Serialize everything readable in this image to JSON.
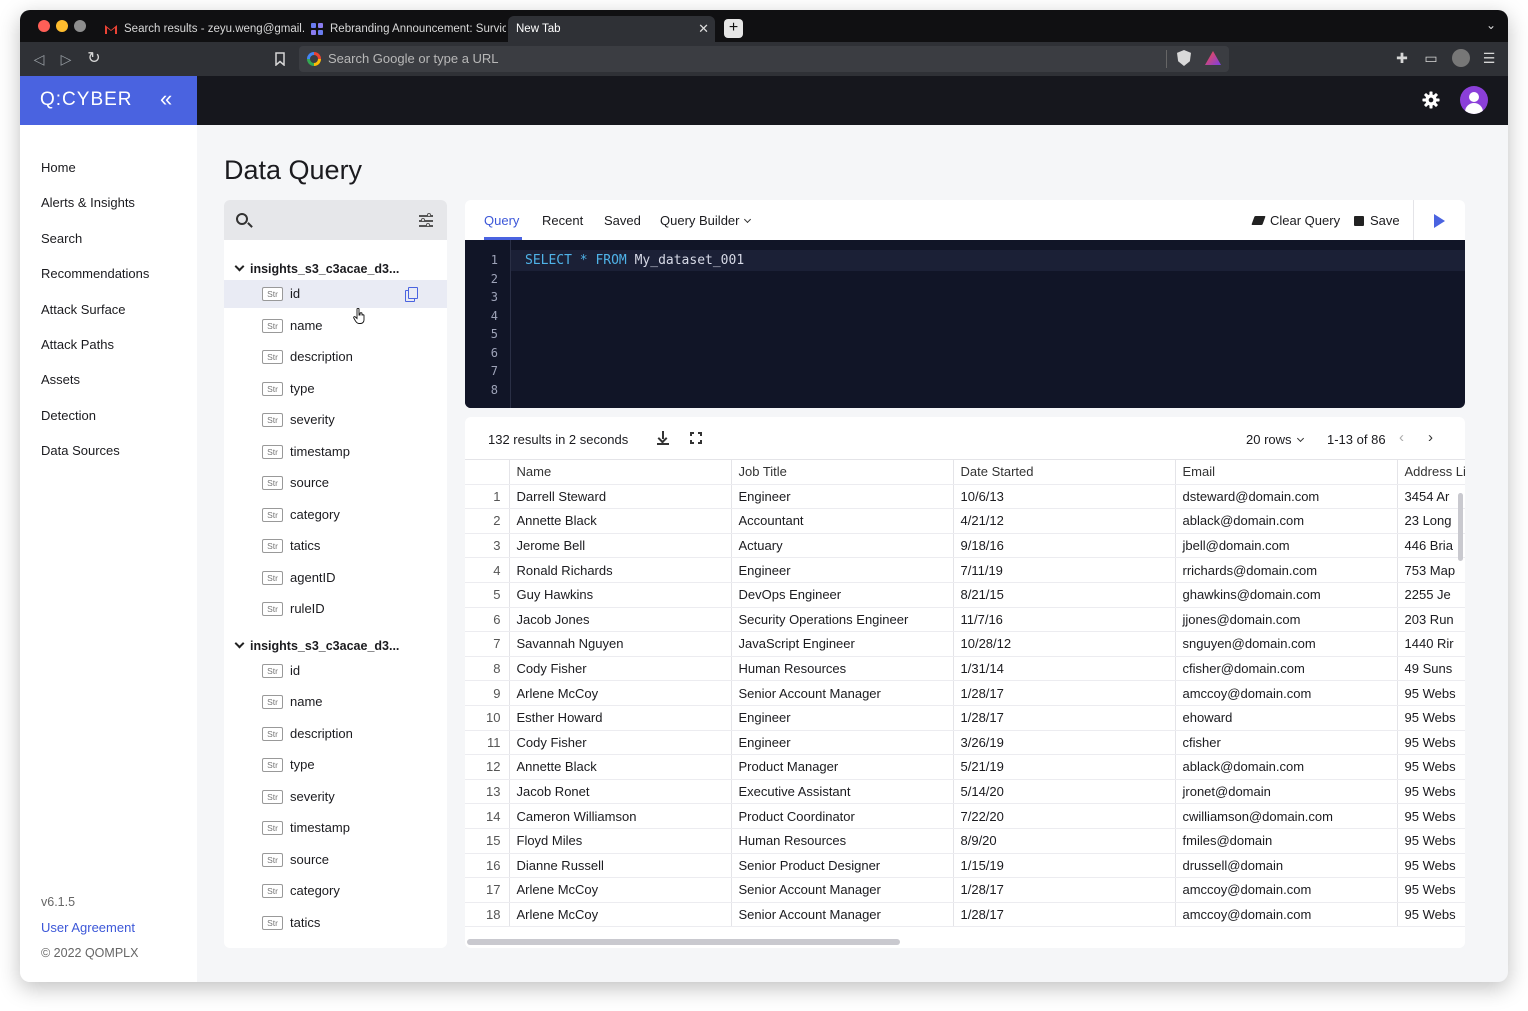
{
  "browser": {
    "tabs": [
      {
        "title": "Search results - zeyu.weng@gmail.com"
      },
      {
        "title": "Rebranding Announcement: Survicate"
      },
      {
        "title": "New Tab"
      }
    ],
    "omnibox_placeholder": "Search Google or type a URL"
  },
  "app": {
    "logo": "Q:CYBER",
    "colors": {
      "brand": "#4a63e0",
      "header": "#16171d",
      "editor": "#111527",
      "keyword": "#4fb3e8"
    }
  },
  "sidebar": {
    "items": [
      "Home",
      "Alerts & Insights",
      "Search",
      "Recommendations",
      "Attack Surface",
      "Attack Paths",
      "Assets",
      "Detection",
      "Data Sources"
    ],
    "version": "v6.1.5",
    "user_agreement": "User Agreement",
    "copyright": "© 2022 QOMPLX"
  },
  "page": {
    "title": "Data Query"
  },
  "schema": {
    "badge": "Str",
    "groups": [
      {
        "name": "insights_s3_c3acae_d3...",
        "fields": [
          "id",
          "name",
          "description",
          "type",
          "severity",
          "timestamp",
          "source",
          "category",
          "tatics",
          "agentID",
          "ruleID"
        ]
      },
      {
        "name": "insights_s3_c3acae_d3...",
        "fields": [
          "id",
          "name",
          "description",
          "type",
          "severity",
          "timestamp",
          "source",
          "category",
          "tatics"
        ]
      }
    ]
  },
  "query": {
    "tabs": [
      "Query",
      "Recent",
      "Saved",
      "Query Builder"
    ],
    "clear": "Clear Query",
    "save": "Save",
    "line_numbers": [
      "1",
      "2",
      "3",
      "4",
      "5",
      "6",
      "7",
      "8"
    ],
    "code": {
      "kw1": "SELECT",
      "op": "*",
      "kw2": "FROM",
      "table": "My_dataset_001"
    }
  },
  "results": {
    "summary": "132 results in 2 seconds",
    "rows_select": "20 rows",
    "page_info": "1-13 of 86",
    "columns": [
      "",
      "Name",
      "Job Title",
      "Date Started",
      "Email",
      "Address Line"
    ],
    "rows": [
      [
        "1",
        "Darrell Steward",
        "Engineer",
        "10/6/13",
        "dsteward@domain.com",
        "3454 Ar"
      ],
      [
        "2",
        "Annette Black",
        "Accountant",
        "4/21/12",
        "ablack@domain.com",
        "23 Long"
      ],
      [
        "3",
        "Jerome Bell",
        "Actuary",
        "9/18/16",
        "jbell@domain.com",
        "446 Bria"
      ],
      [
        "4",
        "Ronald Richards",
        "Engineer",
        "7/11/19",
        "rrichards@domain.com",
        "753 Map"
      ],
      [
        "5",
        "Guy Hawkins",
        "DevOps Engineer",
        "8/21/15",
        "ghawkins@domain.com",
        "2255 Je"
      ],
      [
        "6",
        "Jacob Jones",
        "Security Operations Engineer",
        "11/7/16",
        "jjones@domain.com",
        "203 Run"
      ],
      [
        "7",
        "Savannah Nguyen",
        "JavaScript Engineer",
        "10/28/12",
        "snguyen@domain.com",
        "1440 Rir"
      ],
      [
        "8",
        "Cody Fisher",
        "Human Resources",
        "1/31/14",
        "cfisher@domain.com",
        "49 Suns"
      ],
      [
        "9",
        "Arlene McCoy",
        "Senior Account Manager",
        "1/28/17",
        "amccoy@domain.com",
        "95 Webs"
      ],
      [
        "10",
        "Esther Howard",
        "Engineer",
        "1/28/17",
        "ehoward",
        "95 Webs"
      ],
      [
        "11",
        "Cody Fisher",
        "Engineer",
        "3/26/19",
        "cfisher",
        "95 Webs"
      ],
      [
        "12",
        "Annette Black",
        "Product Manager",
        "5/21/19",
        "ablack@domain.com",
        "95 Webs"
      ],
      [
        "13",
        "Jacob Ronet",
        "Executive Assistant",
        "5/14/20",
        "jronet@domain",
        "95 Webs"
      ],
      [
        "14",
        "Cameron Williamson",
        "Product Coordinator",
        "7/22/20",
        "cwilliamson@domain.com",
        "95 Webs"
      ],
      [
        "15",
        "Floyd Miles",
        "Human Resources",
        "8/9/20",
        "fmiles@domain",
        "95 Webs"
      ],
      [
        "16",
        "Dianne Russell",
        "Senior Product Designer",
        "1/15/19",
        "drussell@domain",
        "95 Webs"
      ],
      [
        "17",
        "Arlene McCoy",
        "Senior Account Manager",
        "1/28/17",
        "amccoy@domain.com",
        "95 Webs"
      ],
      [
        "18",
        "Arlene McCoy",
        "Senior Account Manager",
        "1/28/17",
        "amccoy@domain.com",
        "95 Webs"
      ]
    ]
  }
}
